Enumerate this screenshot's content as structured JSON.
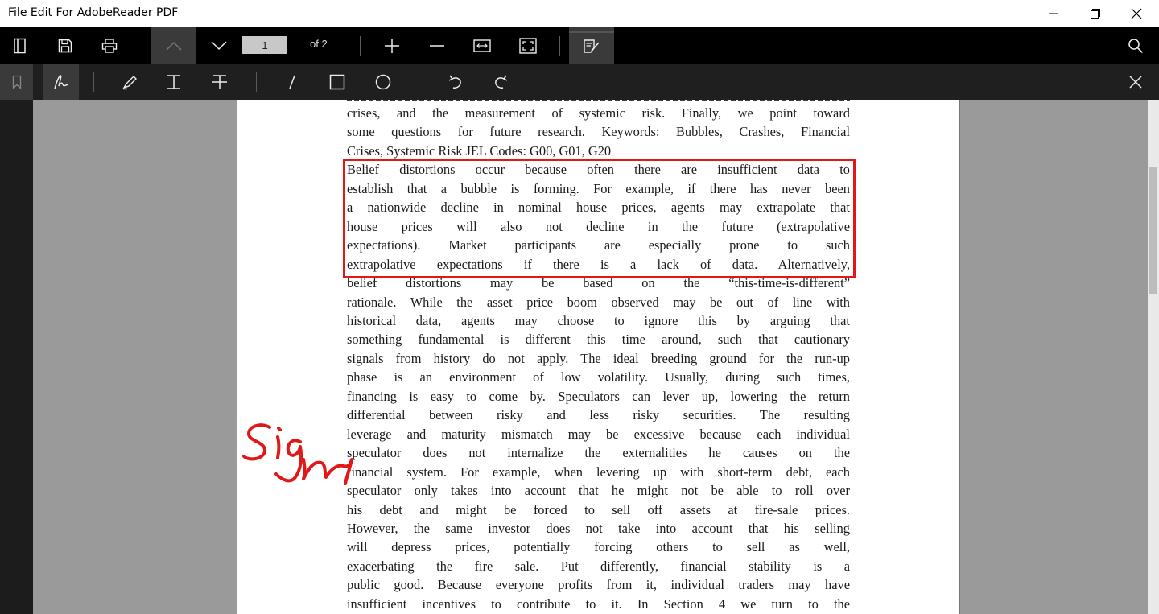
{
  "window": {
    "title": "File Edit For AdobeReader PDF"
  },
  "toolbar": {
    "page_number": "1",
    "of_pages": "of 2"
  },
  "icons": {
    "top": [
      "sidebar-toggle-icon",
      "save-icon",
      "print-icon",
      "previous-page-icon",
      "next-page-icon",
      "zoom-in-icon",
      "zoom-out-icon",
      "fit-width-icon",
      "fit-page-icon",
      "edit-mode-icon",
      "search-icon"
    ],
    "annotate": [
      "bookmark-icon",
      "freehand-pen-icon",
      "highlighter-icon",
      "text-insert-icon",
      "strikethrough-icon",
      "line-icon",
      "rectangle-icon",
      "ellipse-icon",
      "undo-icon",
      "redo-icon",
      "close-icon"
    ]
  },
  "colors": {
    "annotation_red": "#e01818",
    "toolbar_bg": "#000000",
    "workspace_bg": "#9a9a9a"
  },
  "document": {
    "lines": [
      "crises, and the measurement of systemic risk. Finally, we point toward",
      "some questions for future research. Keywords: Bubbles, Crashes, Financial",
      "Crises, Systemic Risk JEL Codes: G00, G01, G20",
      "Belief distortions occur because often there are insufficient data to",
      "establish that a bubble is forming. For example, if there has never been",
      "a nationwide decline in nominal house prices, agents may extrapolate that",
      "house prices will also not decline in the future (extrapolative",
      "expectations). Market participants are especially prone to such",
      "extrapolative expectations if there is a lack of data. Alternatively,",
      "belief distortions may be based on the “this-time-is-different”",
      "rationale. While the asset price boom observed may be out of line with",
      "historical data, agents may choose to ignore this by arguing that",
      "something fundamental is different this time around, such that cautionary",
      "signals from history do not apply. The ideal breeding ground for the run-up",
      "phase is an environment of low volatility. Usually, during such times,",
      "financing is easy to come by. Speculators can lever up, lowering the return",
      "differential between risky and less risky securities. The resulting",
      "leverage and maturity mismatch may be excessive because each individual",
      "speculator does not internalize the externalities he causes on the",
      "financial system. For example, when levering up with short-term debt, each",
      "speculator only takes into account that he might not be able to roll over",
      "his debt and might be forced to sell off assets at fire-sale prices.",
      "However, the same investor does not take into account that his selling",
      "will depress prices, potentially forcing others to sell as well,",
      "exacerbating the fire sale. Put differently, financial stability is a",
      "public good. Because everyone profits from it, individual traders may have",
      "insufficient incentives to contribute to it. In Section 4 we turn to the"
    ],
    "highlighted_line_range": [
      3,
      8
    ],
    "handwritten_annotation": "Sign"
  },
  "scroll_position": 0.13
}
